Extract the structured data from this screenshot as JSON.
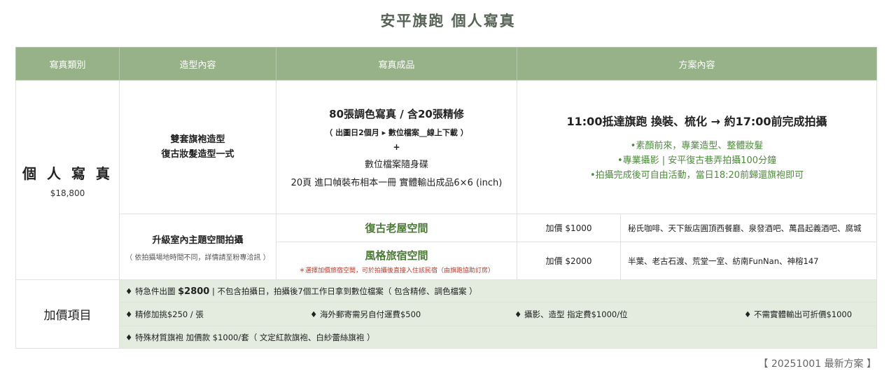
{
  "page_title": "安平旗跑 個人寫真",
  "table": {
    "headers": [
      "寫真類別",
      "造型內容",
      "寫真成品",
      "方案內容"
    ]
  },
  "package": {
    "name": "個 人 寫 真",
    "price": "$18,800",
    "styling_line1": "雙套旗袍造型",
    "styling_line2": "復古妝髮造型一式",
    "product_main": "80張調色寫真 / 含20張精修",
    "product_sub": "（ 出圖日2個月 ▸ 數位檔案__線上下載 ）",
    "product_plus": "+",
    "product_line2": "數位檔案隨身碟",
    "product_line3": "20頁 進口幀裝布相本一冊 實體輸出成品6×6 (inch)",
    "plan_main": "11:00抵達旗跑 換裝、梳化 → 約17:00前完成拍攝",
    "plan_bullets": [
      "•素顏前來，專業造型、整體妝髮",
      "•專業攝影 | 安平復古巷弄拍攝100分鐘",
      "•拍攝完成後可自由活動，當日18:20前歸還旗袍即可"
    ]
  },
  "upgrade": {
    "title": "升級室內主題空間拍攝",
    "subtitle": "（ 依拍攝場地時間不同，詳情請至粉專洽訊 ）",
    "spaces": [
      {
        "name": "復古老屋空間",
        "note": "",
        "price": "加價 $1000",
        "venues": "秘氏咖啡、天下飯店圓頂西餐廳、泉發酒吧、萬昌起義酒吧、腐城"
      },
      {
        "name": "風格旅宿空間",
        "note": "＊選擇加價旅宿空間，可於拍攝後直接入住該民宿（由旗跑協助訂房）",
        "price": "加價 $2000",
        "venues": "半葉、老古石渡、荒堂一室、紡南FunNan、神榕147"
      }
    ]
  },
  "extras": {
    "label": "加價項目",
    "row1_prefix": "♦ 特急件出圖 ",
    "row1_price": "$2800",
    "row1_rest": " | 不包含拍攝日，拍攝後7個工作日拿到數位檔案（ 包含精修、調色檔案 ）",
    "row2_items": [
      "♦ 精修加挑$250 / 張",
      "♦ 海外郵寄需另自付運費$500",
      "♦ 攝影、造型 指定費$1000/位",
      "♦ 不需實體輸出可折價$1000"
    ],
    "row3": "♦ 特殊材質旗袍 加價款 $1000/套（ 文定紅款旗袍、白紗蕾絲旗袍 ）"
  },
  "footer_note": "【 20251001 最新方案 】"
}
